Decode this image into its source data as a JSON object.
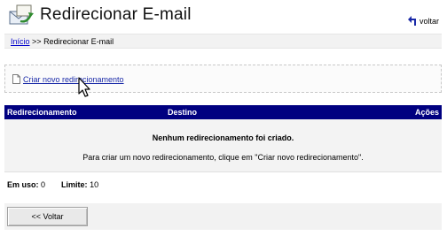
{
  "header": {
    "title": "Redirecionar E-mail",
    "back_label": "voltar",
    "app_icon": "mail-redirect-icon",
    "back_icon": "return-arrow-icon"
  },
  "breadcrumb": {
    "home": "Início",
    "separator": ">>",
    "current": "Redirecionar E-mail"
  },
  "actions": {
    "create_label": "Criar novo redirecionamento",
    "create_icon": "document-icon"
  },
  "table": {
    "columns": [
      "Redirecionamento",
      "Destino",
      "Ações"
    ],
    "header_color": "#000080"
  },
  "empty_state": {
    "title": "Nenhum redirecionamento foi criado.",
    "message": "Para criar um novo redirecionamento, clique em \"Criar novo redirecionamento\"."
  },
  "usage": {
    "in_use_label": "Em uso:",
    "in_use_value": "0",
    "limit_label": "Limite:",
    "limit_value": "10"
  },
  "footer": {
    "back_button": "<< Voltar"
  }
}
